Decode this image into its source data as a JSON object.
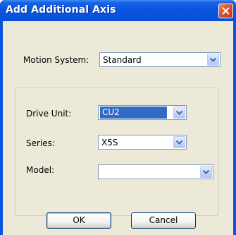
{
  "dialog": {
    "title": "Add Additional Axis"
  },
  "motion_system": {
    "label": "Motion System:",
    "value": "Standard"
  },
  "drive_unit": {
    "label": "Drive Unit:",
    "value": "CU2"
  },
  "series": {
    "label": "Series:",
    "value": "X5S"
  },
  "model": {
    "label": "Model:",
    "value": ""
  },
  "buttons": {
    "ok_label": "OK",
    "cancel_label": "Cancel"
  },
  "colors": {
    "title_bar": "#0a55df",
    "dialog_background": "#ece9d8",
    "selection": "#316ac5",
    "close_button": "#d9542d"
  },
  "icons": {
    "close": "close-icon",
    "dropdown": "chevron-down-icon"
  }
}
